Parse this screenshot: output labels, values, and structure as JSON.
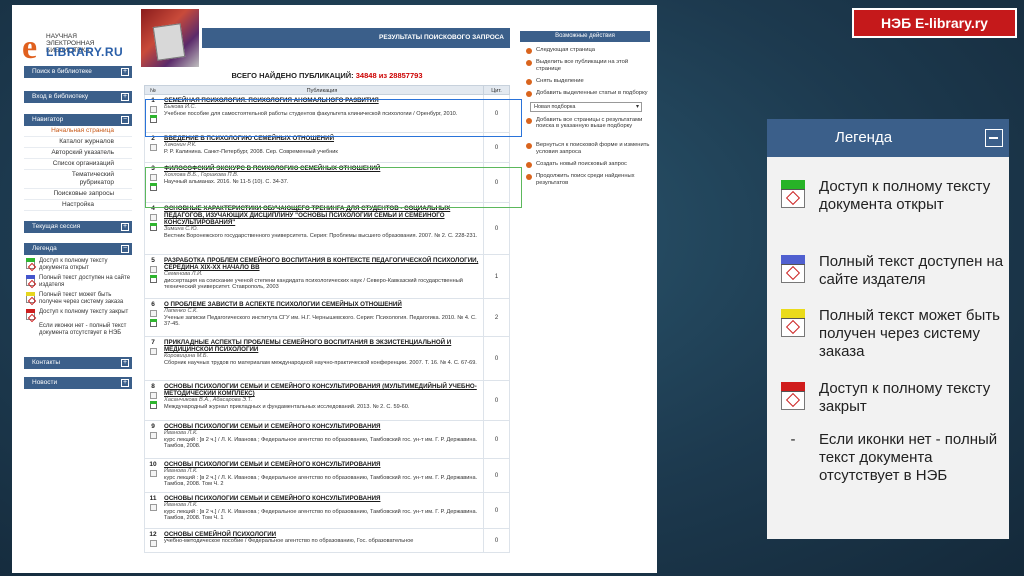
{
  "badge": "НЭБ E-library.ry",
  "logo": {
    "letter": "e",
    "tagline": "НАУЧНАЯ ЭЛЕКТРОННАЯ БИБЛИОТЕКА",
    "name": "LIBRARY.RU"
  },
  "sidebar": {
    "search_btn": "Поиск в библиотеке",
    "login_btn": "Вход в библиотеку",
    "nav_header": "Навигатор",
    "menu": [
      "Начальная страница",
      "Каталог журналов",
      "Авторский указатель",
      "Список организаций",
      "Тематический рубрикатор",
      "Поисковые запросы",
      "Настройка"
    ],
    "session_btn": "Текущая сессия",
    "legend_header": "Легенда",
    "legend": [
      "Доступ к полному тексту документа открыт",
      "Полный текст доступен на сайте издателя",
      "Полный текст может быть получен через систему заказа",
      "Доступ к полному тексту закрыт",
      "Если иконки нет - полный текст документа отсутствует в НЭБ"
    ],
    "contacts_btn": "Контакты",
    "news_btn": "Новости"
  },
  "results": {
    "header": "РЕЗУЛЬТАТЫ ПОИСКОВОГО ЗАПРОСА",
    "found_label": "ВСЕГО НАЙДЕНО ПУБЛИКАЦИЙ:",
    "found_count": "34848 из 28857793",
    "col_num": "№",
    "col_pub": "Публикация",
    "col_cit": "Цит.",
    "rows": [
      {
        "n": "1",
        "title": "СЕМЕЙНАЯ ПСИХОЛОГИЯ. ПСИХОЛОГИЯ АНОМАЛЬНОГО РАЗВИТИЯ",
        "author": "Быкова И.С.",
        "src": "Учебное пособие для самостоятельной работы студентов факультета клинической психологии / Оренбург, 2010.",
        "cit": "0"
      },
      {
        "n": "2",
        "title": "ВВЕДЕНИЕ В ПСИХОЛОГИЮ СЕМЕЙНЫХ ОТНОШЕНИЙ",
        "author": "Хачонин Р.К.",
        "src": "Р. Р. Калинина. Санкт-Петербург, 2008. Сер. Современный учебник",
        "cit": "0"
      },
      {
        "n": "3",
        "title": "ФИЛОСОФСКИЙ ЭКСКУРС В ПСИХОЛОГИЮ СЕМЕЙНЫХ ОТНОШЕНИЙ",
        "author": "Хохлова В.Б., Горшкова П.В.",
        "src": "Научный альманах. 2016. № 11-5 (10). С. 34-37.",
        "cit": "0"
      },
      {
        "n": "4",
        "title": "ОСНОВНЫЕ ХАРАКТЕРИСТИКИ ОБУЧАЮЩЕГО ТРЕНИНГА ДЛЯ СТУДЕНТОВ - СОЦИАЛЬНЫХ ПЕДАГОГОВ, ИЗУЧАЮЩИХ ДИСЦИПЛИНУ \"ОСНОВЫ ПСИХОЛОГИИ СЕМЬИ И СЕМЕЙНОГО КОНСУЛЬТИРОВАНИЯ\"",
        "author": "Зимина С.Ю.",
        "src": "Вестник Воронежского государственного университета. Серия: Проблемы высшего образования. 2007. № 2. С. 228-231.",
        "cit": "0"
      },
      {
        "n": "5",
        "title": "РАЗРАБОТКА ПРОБЛЕМ СЕМЕЙНОГО ВОСПИТАНИЯ В КОНТЕКСТЕ ПЕДАГОГИЧЕСКОЙ ПСИХОЛОГИИ, СЕРЕДИНА XIX-XX НАЧАЛО ВВ",
        "author": "Семенова Л.И.",
        "src": "диссертация на соискание ученой степени кандидата психологических наук / Северо-Кавказский государственный технический университет. Ставрополь, 2003",
        "cit": "1"
      },
      {
        "n": "6",
        "title": "О ПРОБЛЕМЕ ЗАВИСТИ В АСПЕКТЕ ПСИХОЛОГИИ СЕМЕЙНЫХ ОТНОШЕНИЙ",
        "author": "Лапенко С.К.",
        "src": "Ученые записки Педагогического института СГУ им. Н.Г. Чернышевского. Серия: Психология. Педагогика. 2010. № 4. С. 37-45.",
        "cit": "2"
      },
      {
        "n": "7",
        "title": "ПРИКЛАДНЫЕ АСПЕКТЫ ПРОБЛЕМЫ СЕМЕЙНОГО ВОСПИТАНИЯ В ЭКЗИСТЕНЦИАЛЬНОЙ И МЕДИЦИНСКОЙ ПСИХОЛОГИИ",
        "author": "Коровицина М.Б.",
        "src": "Сборник научных трудов по материалам международной научно-практической конференции. 2007. Т. 16. № 4. С. 67-69.",
        "cit": "0"
      },
      {
        "n": "8",
        "title": "ОСНОВЫ ПСИХОЛОГИИ СЕМЬИ И СЕМЕЙНОГО КОНСУЛЬТИРОВАНИЯ (МУЛЬТИМЕДИЙНЫЙ УЧЕБНО-МЕТОДИЧЕСКИЙ КОМПЛЕКС)",
        "author": "Хасанчикова В.А., Абасарова Э.Т.",
        "src": "Международный журнал прикладных и фундаментальных исследований. 2013. № 2. С. 59-60.",
        "cit": "0"
      },
      {
        "n": "9",
        "title": "ОСНОВЫ ПСИХОЛОГИИ СЕМЬИ И СЕМЕЙНОГО КОНСУЛЬТИРОВАНИЯ",
        "author": "Иванова Л.К.",
        "src": "курс лекций : [в 2 ч.] / Л. К. Иванова ; Федеральное агентство по образованию, Тамбовский гос. ун-т им. Г. Р. Державина. Тамбов, 2008.",
        "cit": "0"
      },
      {
        "n": "10",
        "title": "ОСНОВЫ ПСИХОЛОГИИ СЕМЬИ И СЕМЕЙНОГО КОНСУЛЬТИРОВАНИЯ",
        "author": "Иванова Л.К.",
        "src": "курс лекций : [в 2 ч.] / Л. К. Иванова ; Федеральное агентство по образованию, Тамбовский гос. ун-т им. Г. Р. Державина. Тамбов, 2008. Том Ч. 2",
        "cit": "0"
      },
      {
        "n": "11",
        "title": "ОСНОВЫ ПСИХОЛОГИИ СЕМЬИ И СЕМЕЙНОГО КОНСУЛЬТИРОВАНИЯ",
        "author": "Иванова Л.К.",
        "src": "курс лекций : [в 2 ч.] / Л. К. Иванова ; Федеральное агентство по образованию, Тамбовский гос. ун-т им. Г. Р. Державина. Тамбов, 2008. Том Ч. 1",
        "cit": "0"
      },
      {
        "n": "12",
        "title": "ОСНОВЫ СЕМЕЙНОЙ ПСИХОЛОГИИ",
        "author": "",
        "src": "учебно-методическое пособие / Федеральное агентство по образованию, Гос. образовательное",
        "cit": "0"
      }
    ]
  },
  "actions": {
    "header": "Возможные действия",
    "items": [
      "Следующая страница",
      "Выделить все публикации на этой странице",
      "Снять выделение",
      "Добавить выделенные статьи в подборку",
      "Добавить все страницы с результатами поиска в указанную выше подборку",
      "Вернуться к поисковой форме и изменить условия запроса",
      "Создать новый поисковый запрос",
      "Продолжить поиск среди найденных результатов"
    ],
    "select_value": "Новая подборка"
  },
  "legend_zoom": {
    "header": "Легенда",
    "items": [
      "Доступ к полному тексту документа открыт",
      "Полный текст доступен на сайте издателя",
      "Полный текст может быть получен через систему заказа",
      "Доступ к полному тексту закрыт",
      "Если иконки нет - полный текст документа отсутствует в НЭБ"
    ],
    "dash": "-"
  }
}
